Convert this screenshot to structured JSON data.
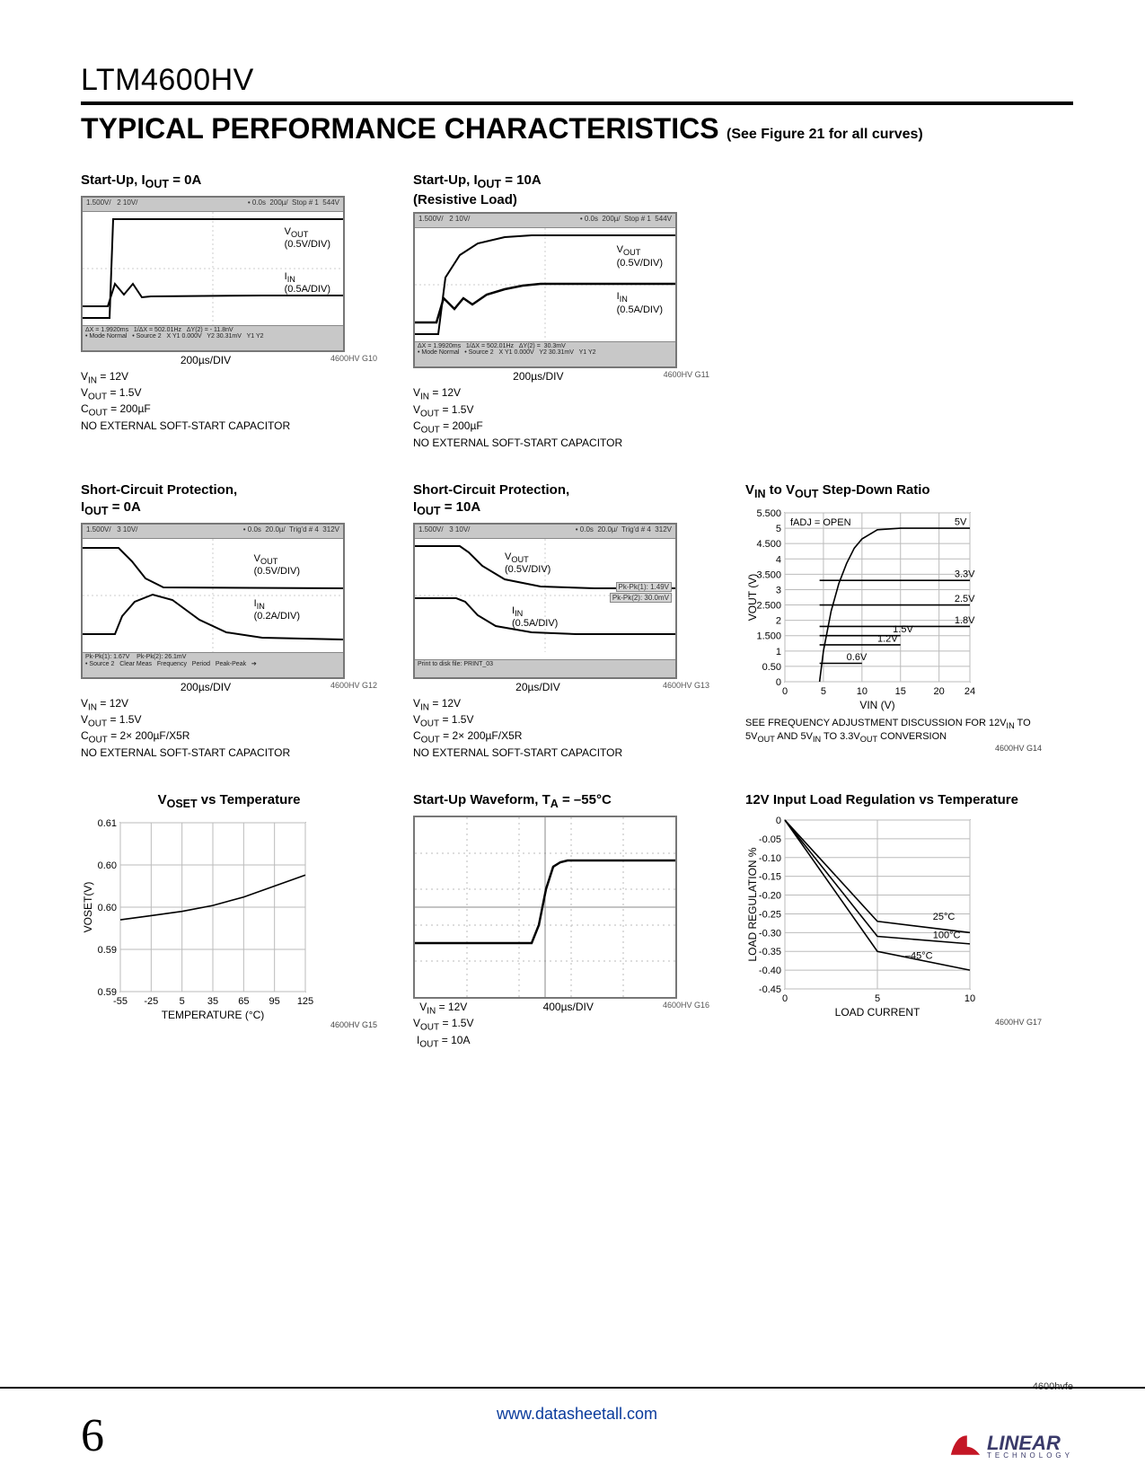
{
  "part_number": "LTM4600HV",
  "section_title": "TYPICAL PERFORMANCE CHARACTERISTICS",
  "section_subtitle": "(See Figure 21 for all curves)",
  "page_number": "6",
  "footer_url": "www.datasheetall.com",
  "doc_id": "4600hvfe",
  "logo_text": "LINEAR",
  "logo_sub": "TECHNOLOGY",
  "scopes": {
    "g10": {
      "title_html": "Start-Up, I<sub>OUT</sub> = 0A",
      "trace1": "V<sub>OUT</sub><br>(0.5V/DIV)",
      "trace2": "I<sub>IN</sub><br>(0.5A/DIV)",
      "xaxis": "200µs/DIV",
      "id": "4600HV G10",
      "conditions": [
        "V<sub>IN</sub> = 12V",
        "V<sub>OUT</sub> = 1.5V",
        "C<sub>OUT</sub> = 200µF",
        "NO EXTERNAL SOFT-START CAPACITOR"
      ]
    },
    "g11": {
      "title_html": "Start-Up, I<sub>OUT</sub> = 10A<br>(Resistive Load)",
      "trace1": "V<sub>OUT</sub><br>(0.5V/DIV)",
      "trace2": "I<sub>IN</sub><br>(0.5A/DIV)",
      "xaxis": "200µs/DIV",
      "id": "4600HV G11",
      "conditions": [
        "V<sub>IN</sub> = 12V",
        "V<sub>OUT</sub> = 1.5V",
        "C<sub>OUT</sub> = 200µF",
        "NO EXTERNAL SOFT-START CAPACITOR"
      ]
    },
    "g12": {
      "title_html": "Short-Circuit Protection,<br>I<sub>OUT</sub> = 0A",
      "trace1": "V<sub>OUT</sub><br>(0.5V/DIV)",
      "trace2": "I<sub>IN</sub><br>(0.2A/DIV)",
      "xaxis": "200µs/DIV",
      "id": "4600HV G12",
      "conditions": [
        "V<sub>IN</sub> = 12V",
        "V<sub>OUT</sub> = 1.5V",
        "C<sub>OUT</sub> = 2× 200µF/X5R",
        "NO EXTERNAL SOFT-START CAPACITOR"
      ]
    },
    "g13": {
      "title_html": "Short-Circuit Protection,<br>I<sub>OUT</sub> = 10A",
      "trace1": "V<sub>OUT</sub><br>(0.5V/DIV)",
      "trace2": "I<sub>IN</sub><br>(0.5A/DIV)",
      "xaxis": "20µs/DIV",
      "id": "4600HV G13",
      "conditions": [
        "V<sub>IN</sub> = 12V",
        "V<sub>OUT</sub> = 1.5V",
        "C<sub>OUT</sub> = 2× 200µF/X5R",
        "NO EXTERNAL SOFT-START CAPACITOR"
      ],
      "pkpk": [
        "Pk-Pk(1): 1.49V",
        "Pk-Pk(2): 30.0mV"
      ]
    },
    "g16": {
      "title_html": "Start-Up Waveform, T<sub>A</sub> = –55°C",
      "xaxis": "400µs/DIV",
      "id": "4600HV G16",
      "conditions": [
        "V<sub>IN</sub> = 12V",
        "V<sub>OUT</sub> = 1.5V",
        "I<sub>OUT</sub> = 10A"
      ]
    }
  },
  "chart_data": [
    {
      "id": "4600HV G14",
      "title_html": "V<sub>IN</sub> to V<sub>OUT</sub> Step-Down Ratio",
      "type": "line",
      "xlabel_html": "V<sub>IN</sub> (V)",
      "ylabel_html": "V<sub>OUT</sub> (V)",
      "xlim": [
        0,
        24
      ],
      "ylim": [
        0,
        5.5
      ],
      "xticks": [
        0,
        5,
        10,
        15,
        20,
        24
      ],
      "yticks": [
        0,
        0.5,
        1.0,
        1.5,
        2.0,
        2.5,
        3.0,
        3.5,
        4.0,
        4.5,
        5.0,
        5.5
      ],
      "annotation": "f<sub>ADJ</sub> = OPEN",
      "series": [
        {
          "name": "5V",
          "x": [
            4.5,
            5,
            6,
            7,
            8,
            9,
            10,
            12,
            15,
            20,
            24
          ],
          "y": [
            0,
            1.0,
            2.3,
            3.2,
            3.85,
            4.35,
            4.65,
            4.95,
            5.0,
            5.0,
            5.0
          ]
        },
        {
          "name": "3.3V",
          "x": [
            4.5,
            24
          ],
          "y": [
            3.3,
            3.3
          ]
        },
        {
          "name": "2.5V",
          "x": [
            4.5,
            24
          ],
          "y": [
            2.5,
            2.5
          ]
        },
        {
          "name": "1.8V",
          "x": [
            4.5,
            24
          ],
          "y": [
            1.8,
            1.8
          ]
        },
        {
          "name": "1.5V",
          "x": [
            4.5,
            15
          ],
          "y": [
            1.5,
            1.5
          ]
        },
        {
          "name": "1.2V",
          "x": [
            4.5,
            15
          ],
          "y": [
            1.2,
            1.2
          ]
        },
        {
          "name": "0.6V",
          "x": [
            4.5,
            10
          ],
          "y": [
            0.6,
            0.6
          ]
        }
      ],
      "series_labels": [
        {
          "text": "5V",
          "x": 22,
          "y": 5.05
        },
        {
          "text": "3.3V",
          "x": 22,
          "y": 3.35
        },
        {
          "text": "2.5V",
          "x": 22,
          "y": 2.55
        },
        {
          "text": "1.8V",
          "x": 22,
          "y": 1.85
        },
        {
          "text": "1.5V",
          "x": 14,
          "y": 1.55
        },
        {
          "text": "1.2V",
          "x": 12,
          "y": 1.25
        },
        {
          "text": "0.6V",
          "x": 8,
          "y": 0.65
        }
      ],
      "note_html": "SEE FREQUENCY ADJUSTMENT DISCUSSION FOR 12V<sub>IN</sub> TO 5V<sub>OUT</sub> AND 5V<sub>IN</sub> TO 3.3V<sub>OUT</sub> CONVERSION"
    },
    {
      "id": "4600HV G15",
      "title_html": "V<sub>OSET</sub> vs Temperature",
      "type": "line",
      "xlabel": "TEMPERATURE (°C)",
      "ylabel_html": "V<sub>OSET</sub>(V)",
      "xlim": [
        -55,
        125
      ],
      "ylim": [
        0.59,
        0.61
      ],
      "xticks": [
        -55,
        -25,
        5,
        35,
        65,
        95,
        125
      ],
      "yticks": [
        0.59,
        0.595,
        0.6,
        0.605,
        0.61
      ],
      "series": [
        {
          "name": "Voset",
          "x": [
            -55,
            -25,
            5,
            35,
            65,
            95,
            125
          ],
          "y": [
            0.5985,
            0.599,
            0.5995,
            0.6002,
            0.6012,
            0.6025,
            0.6038
          ]
        }
      ]
    },
    {
      "id": "4600HV G17",
      "title_html": "12V Input Load Regulation vs Temperature",
      "type": "line",
      "xlabel": "LOAD CURRENT",
      "ylabel": "LOAD REGULATION %",
      "xlim": [
        0,
        10
      ],
      "ylim": [
        -0.45,
        0.0
      ],
      "xticks": [
        0,
        5,
        10
      ],
      "yticks": [
        0.0,
        -0.05,
        -0.1,
        -0.15,
        -0.2,
        -0.25,
        -0.3,
        -0.35,
        -0.4,
        -0.45
      ],
      "series": [
        {
          "name": "25°C",
          "x": [
            0,
            5,
            10
          ],
          "y": [
            0,
            -0.27,
            -0.3
          ]
        },
        {
          "name": "100°C",
          "x": [
            0,
            5,
            10
          ],
          "y": [
            0,
            -0.31,
            -0.33
          ]
        },
        {
          "name": "–45°C",
          "x": [
            0,
            5,
            10
          ],
          "y": [
            0,
            -0.35,
            -0.4
          ]
        }
      ],
      "series_labels": [
        {
          "text": "25°C",
          "x": 8,
          "y": -0.27
        },
        {
          "text": "100°C",
          "x": 8,
          "y": -0.32
        },
        {
          "text": "–45°C",
          "x": 6.5,
          "y": -0.375
        }
      ]
    }
  ]
}
